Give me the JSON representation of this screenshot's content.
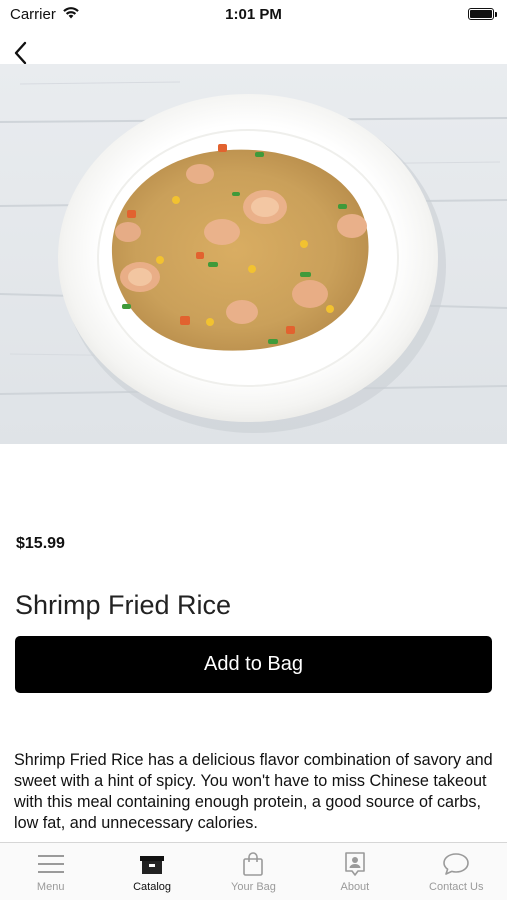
{
  "status_bar": {
    "carrier": "Carrier",
    "time": "1:01 PM"
  },
  "product": {
    "price": "$15.99",
    "name": "Shrimp Fried Rice",
    "add_button_label": "Add to Bag",
    "description": "Shrimp Fried Rice has a delicious flavor combination of savory and sweet with a hint of spicy. You won't have to miss Chinese takeout with this meal containing enough protein, a good source of carbs, low fat, and unnecessary calories."
  },
  "tab_bar": {
    "items": [
      {
        "label": "Menu",
        "icon": "menu-icon",
        "active": false
      },
      {
        "label": "Catalog",
        "icon": "catalog-icon",
        "active": true
      },
      {
        "label": "Your Bag",
        "icon": "bag-icon",
        "active": false
      },
      {
        "label": "About",
        "icon": "about-icon",
        "active": false
      },
      {
        "label": "Contact Us",
        "icon": "chat-icon",
        "active": false
      }
    ]
  },
  "colors": {
    "active_tab": "#111111",
    "inactive_tab": "#9a9a9a",
    "button_bg": "#000000"
  }
}
